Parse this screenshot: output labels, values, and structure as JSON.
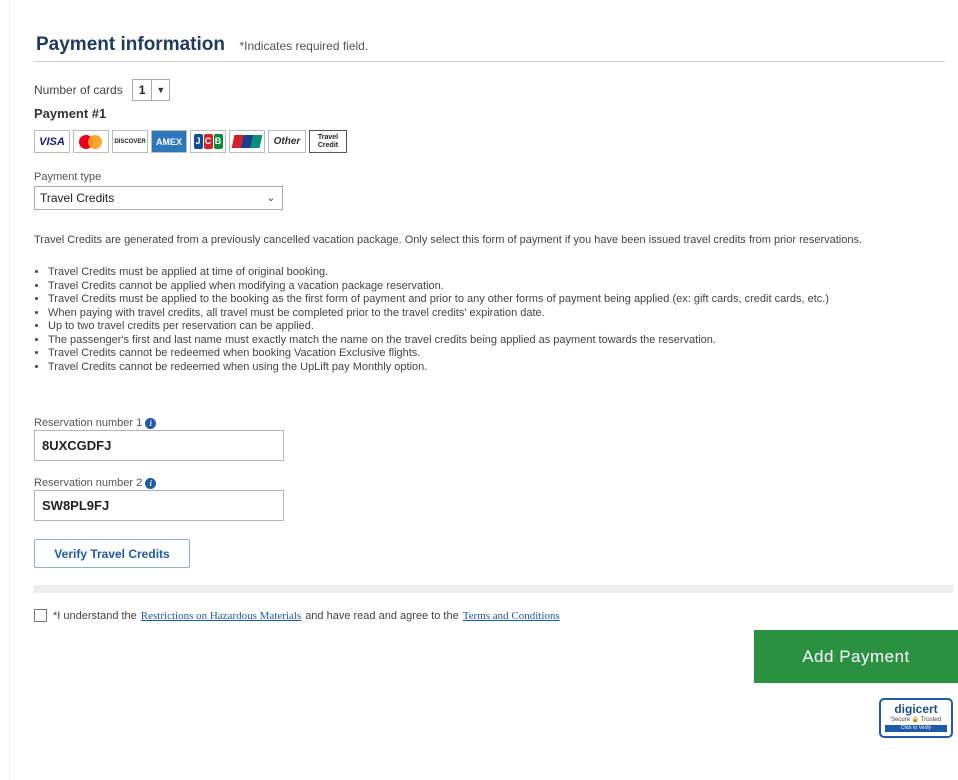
{
  "header": {
    "title": "Payment information",
    "required_note": "*Indicates required field."
  },
  "cards": {
    "label": "Number of cards",
    "selected": "1"
  },
  "payment": {
    "heading": "Payment #1",
    "logos": [
      "VISA",
      "MasterCard",
      "DISCOVER",
      "AMEX",
      "JCB",
      "UnionPay",
      "Other",
      "Travel Credit"
    ],
    "type_label": "Payment type",
    "type_selected": "Travel Credits"
  },
  "description": "Travel Credits are generated from a previously cancelled vacation package. Only select this form of payment if you have been issued travel credits from prior reservations.",
  "rules": [
    "Travel Credits must be applied at time of original booking.",
    "Travel Credits cannot be applied when modifying a vacation package reservation.",
    "Travel Credits must be applied to the booking as the first form of payment and prior to any other forms of payment being applied (ex: gift cards, credit cards, etc.)",
    "When paying with travel credits, all travel must be completed prior to the travel credits' expiration date.",
    "Up to two travel credits per reservation can be applied.",
    "The passenger's first and last name must exactly match the name on the travel credits being applied as payment towards the reservation.",
    "Travel Credits cannot be redeemed when booking Vacation Exclusive flights.",
    "Travel Credits cannot be redeemed when using the UpLift pay Monthly option."
  ],
  "reservation1": {
    "label": "Reservation number 1",
    "value": "8UXCGDFJ"
  },
  "reservation2": {
    "label": "Reservation number 2",
    "value": "SW8PL9FJ"
  },
  "verify_label": "Verify Travel Credits",
  "terms": {
    "prefix": "*I understand the",
    "link1": "Restrictions on Hazardous Materials",
    "middle": "and have read and agree to the",
    "link2": "Terms and Conditions"
  },
  "add_payment_label": "Add Payment",
  "badge": {
    "brand": "digicert",
    "sub": "Secure 🔒 Trusted",
    "cta": "Click to Verify"
  },
  "colors": {
    "accent_blue": "#1e5aa8",
    "add_button_green": "#2a9142"
  }
}
